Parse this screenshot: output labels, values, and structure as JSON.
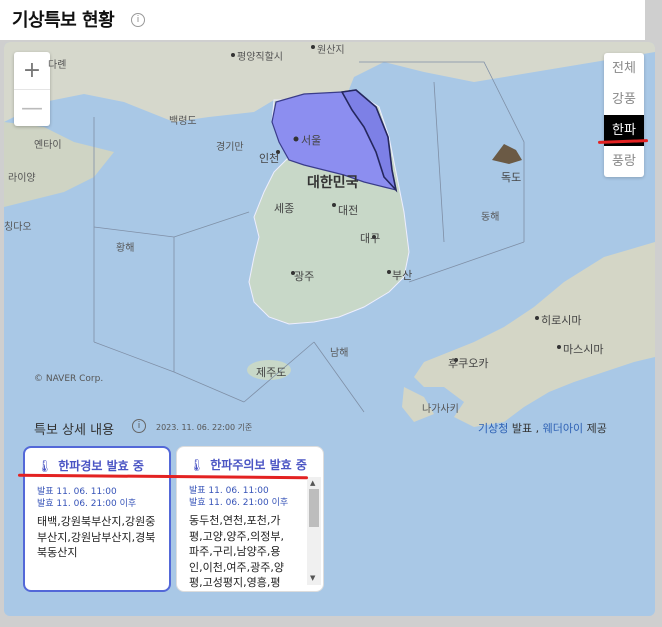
{
  "header": {
    "title": "기상특보 현황"
  },
  "map": {
    "zoom_in": "+",
    "zoom_out": "—",
    "copyright": "© NAVER Corp.",
    "labels": {
      "pyongyang": "평양직할시",
      "wonsan": "원산지",
      "dalian": "다롄",
      "baengnyeong": "백령도",
      "yantai": "옌타이",
      "laiyang": "라이양",
      "gyeonggi_bay": "경기만",
      "seoul": "서울",
      "incheon": "인천",
      "korea": "대한민국",
      "sejong": "세종",
      "daejeon": "대전",
      "daegu": "대구",
      "yellow_sea": "황해",
      "east_sea": "동해",
      "dokdo": "독도",
      "gwangju": "광주",
      "busan": "부산",
      "south_sea": "남해",
      "jeju": "제주도",
      "hiroshima": "히로시마",
      "matsushima": "마스시마",
      "fukuoka": "후쿠오카",
      "nagasaki": "나가사키",
      "qingdao": "칭다오"
    }
  },
  "filters": {
    "all": "전체",
    "wind_waves": "강풍",
    "cold_wave": "한파",
    "waves": "풍랑"
  },
  "detail": {
    "title": "특보 상세 내용",
    "date": "2023. 11. 06. 22:00 기준",
    "credit_org": "기상청",
    "credit_announce": " 발표 , ",
    "credit_partner": "웨더아이",
    "credit_provide": " 제공"
  },
  "cards": [
    {
      "title": "한파경보 발효 중",
      "issued": "발표  11. 06. 11:00",
      "effective": "발효  11. 06. 21:00 이후",
      "regions": "태백,강원북부산지,강원중부산지,강원남부산지,경북북동산지"
    },
    {
      "title": "한파주의보 발효 중",
      "issued": "발표  11. 06. 11:00",
      "effective": "발효  11. 06. 21:00 이후",
      "regions": "동두천,연천,포천,가평,고양,양주,의정부,파주,구리,남양주,용인,이천,여주,광주,양평,고성평지,영흥,평"
    }
  ],
  "colors": {
    "sea": "#a9c8e6",
    "land": "#c8d8c8",
    "alert": "#8c8ef0",
    "accent": "#e32222",
    "card_border": "#5368d8"
  }
}
